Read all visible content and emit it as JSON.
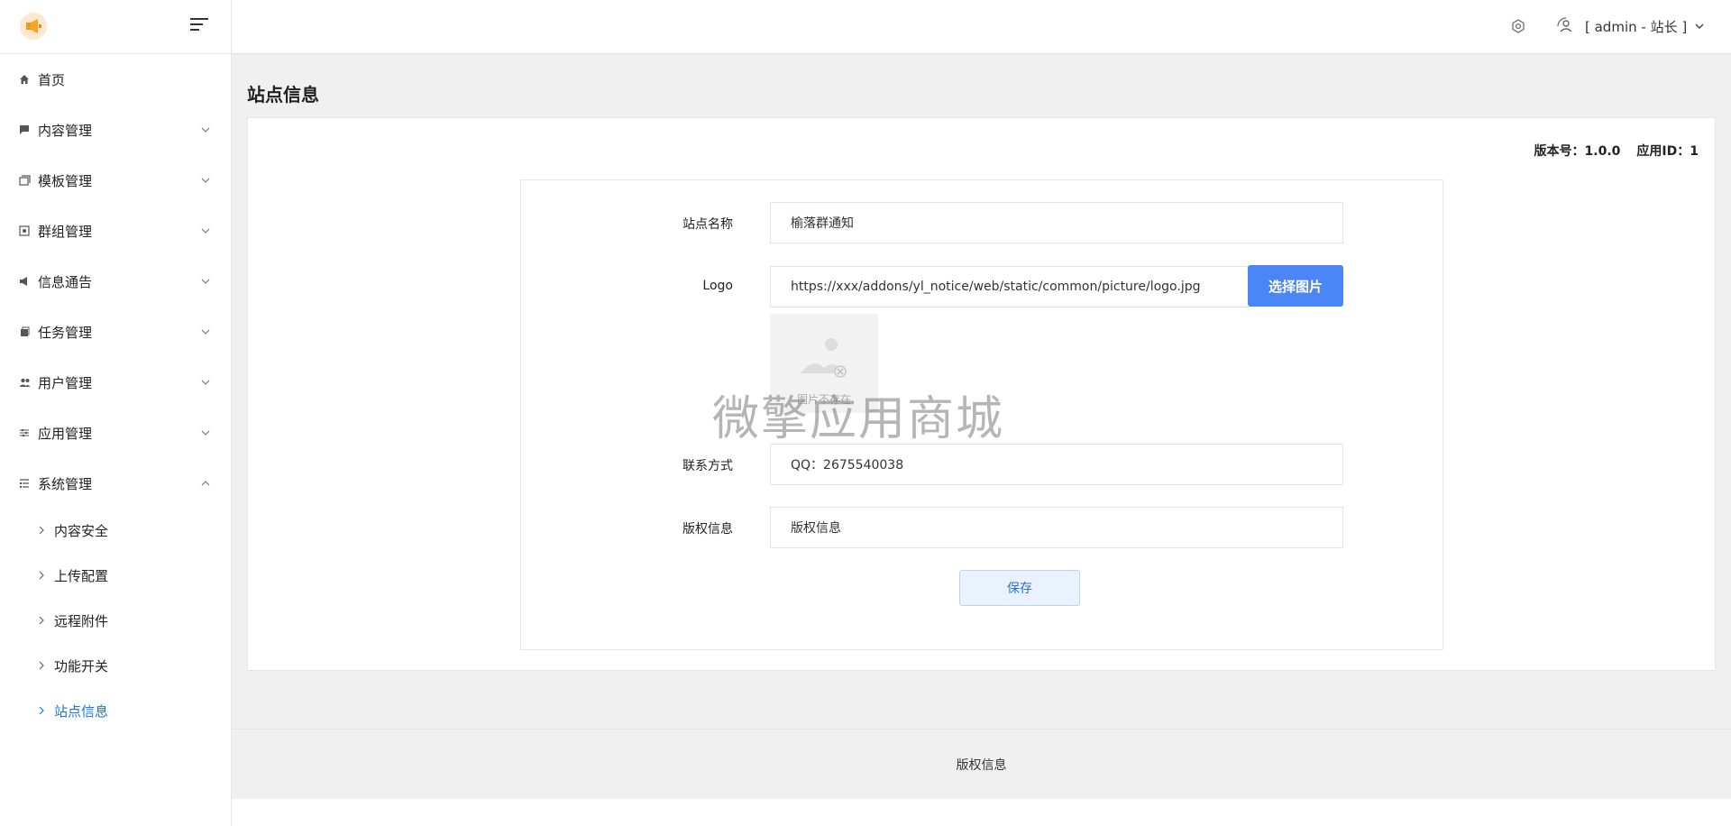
{
  "sidebar": {
    "items": [
      {
        "label": "首页",
        "icon": "home-icon"
      },
      {
        "label": "内容管理",
        "icon": "comment-icon"
      },
      {
        "label": "模板管理",
        "icon": "template-icon"
      },
      {
        "label": "群组管理",
        "icon": "group-icon"
      },
      {
        "label": "信息通告",
        "icon": "megaphone-icon"
      },
      {
        "label": "任务管理",
        "icon": "task-icon"
      },
      {
        "label": "用户管理",
        "icon": "users-icon"
      },
      {
        "label": "应用管理",
        "icon": "sliders-icon"
      },
      {
        "label": "系统管理",
        "icon": "list-icon"
      }
    ],
    "sub_items": [
      {
        "label": "内容安全"
      },
      {
        "label": "上传配置"
      },
      {
        "label": "远程附件"
      },
      {
        "label": "功能开关"
      },
      {
        "label": "站点信息"
      }
    ]
  },
  "header": {
    "user_label": "[ admin - 站长 ]"
  },
  "page": {
    "title": "站点信息",
    "version_text": "版本号：1.0.0",
    "appid_text": "应用ID：1"
  },
  "form": {
    "site_name_label": "站点名称",
    "site_name_value": "榆落群通知",
    "logo_label": "Logo",
    "logo_value": "https://xxx/addons/yl_notice/web/static/common/picture/logo.jpg",
    "pick_image_label": "选择图片",
    "image_placeholder_text": "图片不存在",
    "contact_label": "联系方式",
    "contact_value": "QQ：2675540038",
    "copyright_label": "版权信息",
    "copyright_value": "版权信息",
    "save_label": "保存"
  },
  "watermark": "微擎应用商城",
  "footer": {
    "text": "版权信息"
  },
  "colors": {
    "accent": "#4b86f6",
    "active_link": "#1a73e8",
    "background": "#f0f0f0"
  }
}
